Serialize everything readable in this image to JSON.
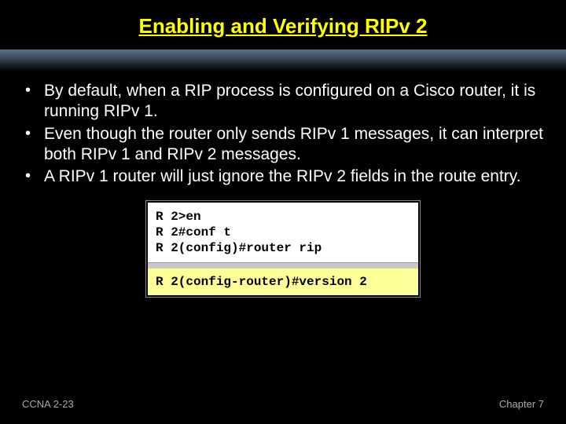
{
  "title": "Enabling and Verifying RIPv 2",
  "bullets": [
    "By default, when a RIP process is configured on a Cisco router, it is running RIPv 1.",
    "Even though the router only sends RIPv 1 messages, it can interpret both RIPv 1 and RIPv 2 messages.",
    "A RIPv 1 router will just ignore the RIPv 2 fields in the route entry."
  ],
  "terminal": {
    "line1": "R 2>en",
    "line2": "R 2#conf t",
    "line3": "R 2(config)#router rip",
    "line4": "R 2(config-router)#version 2"
  },
  "footer": {
    "left": "CCNA 2-23",
    "right": "Chapter 7"
  }
}
